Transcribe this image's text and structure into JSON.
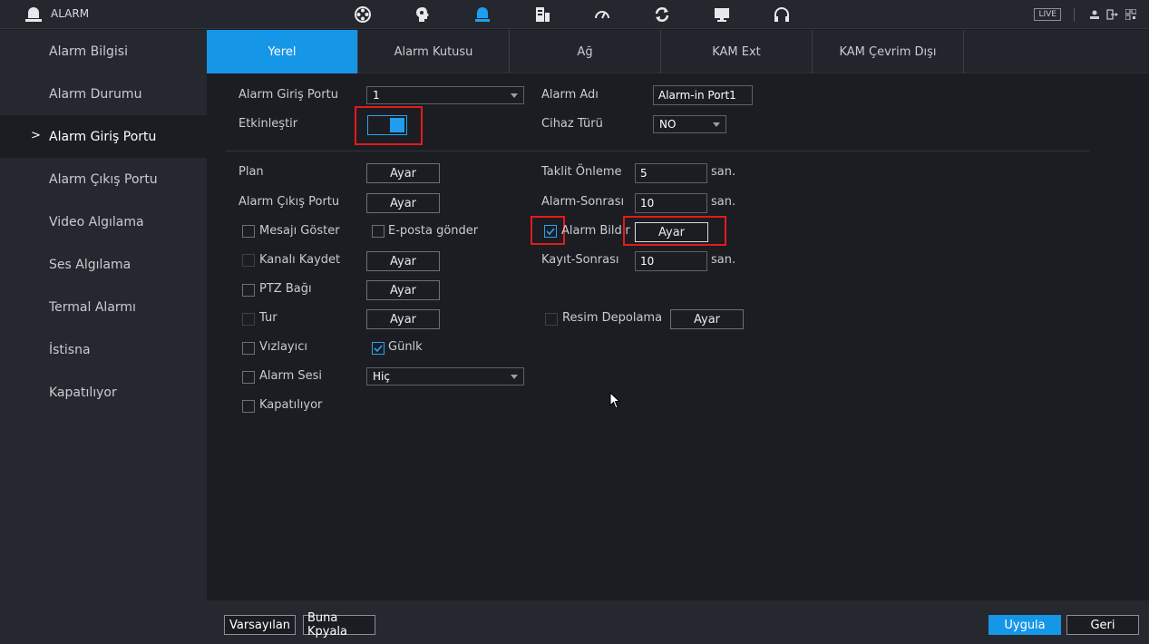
{
  "app": {
    "title": "ALARM",
    "live": "LIVE"
  },
  "top_icons": [
    "film-reel-icon",
    "brain-chip-icon",
    "alarm-bell-icon",
    "hdd-icon",
    "speedometer-icon",
    "refresh-icon",
    "monitor-icon",
    "headset-icon"
  ],
  "sidebar": {
    "items": [
      {
        "label": "Alarm Bilgisi"
      },
      {
        "label": "Alarm Durumu"
      },
      {
        "label": "Alarm Giriş Portu",
        "active": true
      },
      {
        "label": "Alarm Çıkış Portu"
      },
      {
        "label": "Video Algılama"
      },
      {
        "label": "Ses Algılama"
      },
      {
        "label": "Termal Alarmı"
      },
      {
        "label": "İstisna"
      },
      {
        "label": "Kapatılıyor"
      }
    ],
    "chevron": ">"
  },
  "tabs": [
    {
      "label": "Yerel",
      "active": true
    },
    {
      "label": "Alarm Kutusu"
    },
    {
      "label": "Ağ"
    },
    {
      "label": "KAM Ext"
    },
    {
      "label": "KAM Çevrim Dışı"
    }
  ],
  "form": {
    "alarm_input_port_label": "Alarm Giriş Portu",
    "alarm_input_port_value": "1",
    "alarm_name_label": "Alarm Adı",
    "alarm_name_value": "Alarm-in Port1",
    "enable_label": "Etkinleştir",
    "enable_on": true,
    "device_type_label": "Cihaz Türü",
    "device_type_value": "NO",
    "plan_label": "Plan",
    "alarm_out_label": "Alarm Çıkış Portu",
    "show_message_label": "Mesajı Göster",
    "send_email_label": "E-posta gönder",
    "record_channel_label": "Kanalı Kaydet",
    "ptz_label": "PTZ Bağı",
    "tour_label": "Tur",
    "buzzer_label": "Vızlayıcı",
    "log_label": "Günlk",
    "alarm_sound_label": "Alarm Sesi",
    "alarm_sound_value": "Hiç",
    "shutdown_label": "Kapatılıyor",
    "anti_dither_label": "Taklit Önleme",
    "anti_dither_value": "5",
    "post_alarm_label": "Alarm-Sonrası",
    "post_alarm_value": "10",
    "alarm_report_label": "Alarm Bildir",
    "post_record_label": "Kayıt-Sonrası",
    "post_record_value": "10",
    "snapshot_label": "Resim Depolama",
    "unit_sec": "san.",
    "set_button": "Ayar"
  },
  "bottom": {
    "default_label": "Varsayılan",
    "copy_label": "Buna Kpyala",
    "apply_label": "Uygula",
    "back_label": "Geri"
  },
  "colors": {
    "accent": "#1696e6",
    "highlight": "#e21b1b"
  }
}
